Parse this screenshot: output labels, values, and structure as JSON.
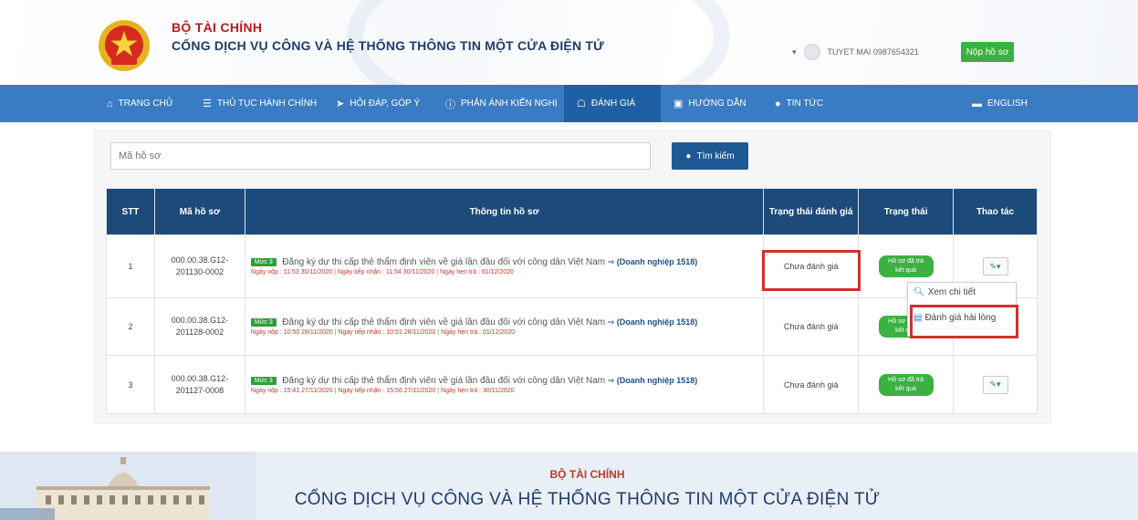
{
  "header": {
    "brand_line1": "BỘ TÀI CHÍNH",
    "brand_line2": "CỔNG DỊCH VỤ CÔNG VÀ HỆ THỐNG THÔNG TIN MỘT CỬA ĐIỆN TỬ",
    "user_name": "TUYET MAI 0987654321",
    "submit_label": "Nộp hồ sơ"
  },
  "nav": {
    "items": [
      {
        "icon": "home-icon",
        "label": "TRANG CHỦ"
      },
      {
        "icon": "list-icon",
        "label": "THỦ TỤC HÀNH CHÍNH"
      },
      {
        "icon": "megaphone-icon",
        "label": "HỎI ĐÁP, GÓP Ý"
      },
      {
        "icon": "info-icon",
        "label": "PHẢN ÁNH KIẾN NGHỊ"
      },
      {
        "icon": "chat-icon",
        "label": "ĐÁNH GIÁ"
      },
      {
        "icon": "book-icon",
        "label": "HƯỚNG DẪN"
      },
      {
        "icon": "location-icon",
        "label": "TIN TỨC"
      },
      {
        "icon": "flag-icon",
        "label": "ENGLISH"
      }
    ],
    "active_index": 4
  },
  "search": {
    "placeholder": "Mã hồ sơ",
    "button_label": "Tìm kiếm"
  },
  "table": {
    "headers": [
      "STT",
      "Mã hồ sơ",
      "Thông tin hồ sơ",
      "Trạng thái đánh giá",
      "Trạng thái",
      "Thao tác"
    ],
    "rows": [
      {
        "stt": "1",
        "code_a": "000.00.38.G12-",
        "code_b": "201130-0002",
        "badge": "Mức 3",
        "title": "Đăng ký dự thi cấp thẻ thẩm định viên về giá lần đầu đối với công dân Việt Nam",
        "org": "(Doanh nghiệp 1518)",
        "submit_date": "Ngày nộp : 11:53 30/11/2020",
        "receive_date": "Ngày tiếp nhận : 11:54 30/11/2020",
        "return_date": "Ngày hẹn trả : 01/12/2020",
        "eval": "Chưa đánh giá",
        "status": "Hồ sơ đã trả kết quả"
      },
      {
        "stt": "2",
        "code_a": "000.00.38.G12-",
        "code_b": "201128-0002",
        "badge": "Mức 3",
        "title": "Đăng ký dự thi cấp thẻ thẩm định viên về giá lần đầu đối với công dân Việt Nam",
        "org": "(Doanh nghiệp 1518)",
        "submit_date": "Ngày nộp : 10:50 28/11/2020",
        "receive_date": "Ngày tiếp nhận : 10:51 28/11/2020",
        "return_date": "Ngày hẹn trả : 01/12/2020",
        "eval": "Chưa đánh giá",
        "status": "Hồ sơ đã trả kết quả"
      },
      {
        "stt": "3",
        "code_a": "000.00.38.G12-",
        "code_b": "201127-0008",
        "badge": "Mức 3",
        "title": "Đăng ký dự thi cấp thẻ thẩm định viên về giá lần đầu đối với công dân Việt Nam",
        "org": "(Doanh nghiệp 1518)",
        "submit_date": "Ngày nộp : 15:41 27/11/2020",
        "receive_date": "Ngày tiếp nhận : 15:56 27/11/2020",
        "return_date": "Ngày hẹn trả : 30/11/2020",
        "eval": "Chưa đánh giá",
        "status": "Hồ sơ đã trả kết quả"
      }
    ]
  },
  "dropdown": {
    "view_detail": "Xem chi tiết",
    "rate": "Đánh giá hài lòng"
  },
  "footer": {
    "line1": "BỘ TÀI CHÍNH",
    "line2": "CỔNG DỊCH VỤ CÔNG VÀ HỆ THỐNG THÔNG TIN MỘT CỬA ĐIỆN TỬ"
  },
  "colors": {
    "nav_bg": "#3a7cc3",
    "nav_active": "#1f5fa3",
    "table_header": "#1c4a7a",
    "success_green": "#3cb043",
    "highlight_red": "#d32f2f"
  }
}
